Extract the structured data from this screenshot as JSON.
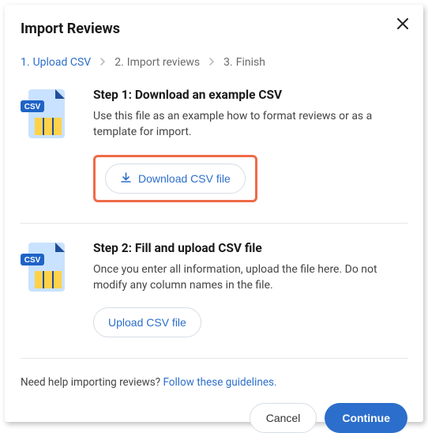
{
  "header": {
    "title": "Import Reviews"
  },
  "breadcrumb": {
    "s1_num": "1.",
    "s1_label": "Upload CSV",
    "s2_num": "2.",
    "s2_label": "Import reviews",
    "s3_num": "3.",
    "s3_label": "Finish"
  },
  "step1": {
    "title": "Step 1: Download an example CSV",
    "desc": "Use this file as an example how to format reviews or as a template for import.",
    "button": "Download CSV file"
  },
  "step2": {
    "title": "Step 2: Fill and upload CSV file",
    "desc": "Once you enter all information, upload the file here. Do not modify any column names in the file.",
    "button": "Upload CSV file"
  },
  "help": {
    "prefix": "Need help importing reviews? ",
    "link": "Follow these guidelines."
  },
  "footer": {
    "cancel": "Cancel",
    "continue": "Continue"
  }
}
